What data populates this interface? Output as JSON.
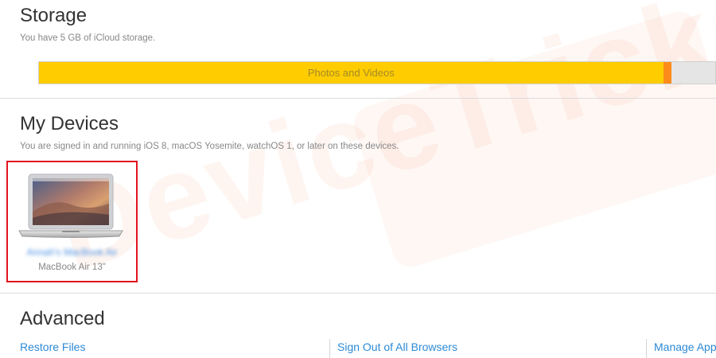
{
  "watermark": {
    "text": "DeviceTricks"
  },
  "storage": {
    "title": "Storage",
    "subtitle": "You have 5 GB of iCloud storage.",
    "bar_label": "Photos and Videos",
    "photos_fraction": 0.923,
    "other_fraction": 0.012,
    "colors": {
      "photos": "#ffcc00",
      "other": "#ff8c1a",
      "free": "#e5e5e5"
    }
  },
  "devices": {
    "title": "My Devices",
    "subtitle": "You are signed in and running iOS 8, macOS Yosemite, watchOS 1, or later on these devices.",
    "items": [
      {
        "name": "Annah's MacBook Air",
        "model": "MacBook Air 13\"",
        "icon": "macbook-air-icon"
      }
    ]
  },
  "advanced": {
    "title": "Advanced",
    "links": [
      "Restore Files",
      "Sign Out of All Browsers",
      "Manage Apps"
    ]
  },
  "highlight_color": "#e2131f"
}
